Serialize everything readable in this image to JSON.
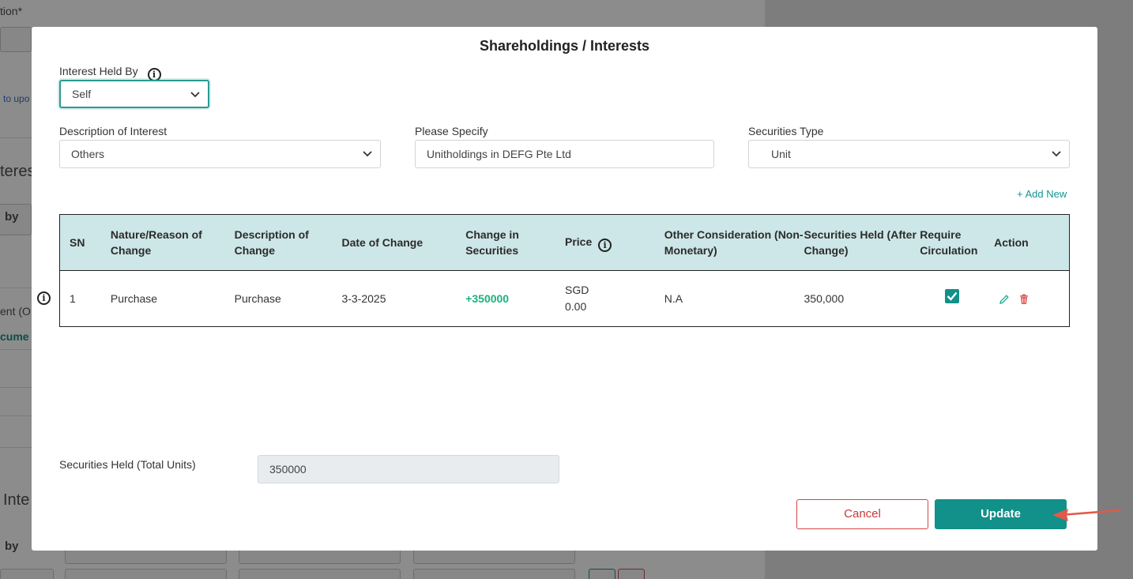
{
  "background": {
    "texts": [
      "tion*",
      "to upo",
      "teres",
      "by",
      "ent (O",
      "cume",
      "Inte",
      "by"
    ]
  },
  "modal": {
    "title": "Shareholdings / Interests",
    "interest_held_by": {
      "label": "Interest Held By",
      "value": "Self"
    },
    "description_of_interest": {
      "label": "Description of Interest",
      "value": "Others"
    },
    "please_specify": {
      "label": "Please Specify",
      "value": "Unitholdings in DEFG Pte Ltd"
    },
    "securities_type": {
      "label": "Securities Type",
      "value": "Unit"
    },
    "add_new": "+ Add New",
    "table": {
      "headers": [
        "SN",
        "Nature/Reason of Change",
        "Description of Change",
        "Date of Change",
        "Change in Securities",
        "Price",
        "Other Consideration (Non-Monetary)",
        "Securities Held (After Change)",
        "Require Circulation",
        "Action"
      ],
      "rows": [
        {
          "sn": "1",
          "nature": "Purchase",
          "description": "Purchase",
          "date": "3-3-2025",
          "change": "+350000",
          "price_currency": "SGD",
          "price_value": "0.00",
          "other_consideration": "N.A",
          "securities_held": "350,000",
          "require_circulation": true
        }
      ]
    },
    "total_units": {
      "label": "Securities Held (Total Units)",
      "value": "350000"
    },
    "buttons": {
      "cancel": "Cancel",
      "update": "Update"
    }
  },
  "colors": {
    "accent": "#12908a",
    "header_bg": "#cde6e7",
    "positive": "#19b37a",
    "danger": "#d64545",
    "arrow": "#e05a4a"
  }
}
